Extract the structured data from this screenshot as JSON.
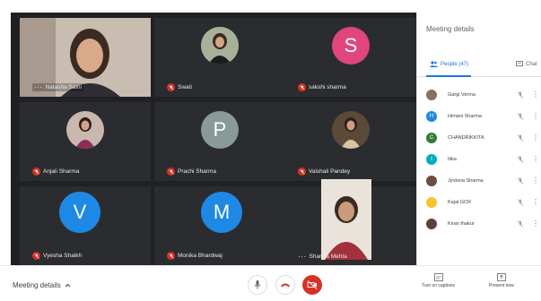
{
  "participants": [
    {
      "name": "Natasha Saini"
    },
    {
      "name": "Swati"
    },
    {
      "name": "sakshi sharma",
      "initial": "S",
      "color": "#e0457b"
    },
    {
      "name": "Anjali Sharma"
    },
    {
      "name": "Prachi Sharma",
      "initial": "P",
      "color": "#8a9a9a"
    },
    {
      "name": "Vaishali Pandey"
    },
    {
      "name": "Vyesha Shaikh",
      "initial": "V",
      "color": "#1e88e5"
    },
    {
      "name": "Monika Bhardwaj",
      "initial": "M",
      "color": "#1e88e5"
    },
    {
      "name": "Sharoja Mehta"
    }
  ],
  "panel": {
    "title": "Meeting details",
    "people_tab": "People (47)",
    "chat_tab": "Chat",
    "people": [
      {
        "name": "Gargi Verma",
        "avatar_color": "#8d6e63"
      },
      {
        "name": "Himani Sharma",
        "initial": "H",
        "avatar_color": "#1e88e5"
      },
      {
        "name": "CHANDRIKKITA",
        "initial": "C",
        "avatar_color": "#2e7d32"
      },
      {
        "name": "Ilika",
        "initial": "I",
        "avatar_color": "#00acc1"
      },
      {
        "name": "Jyotsna Sharma",
        "avatar_color": "#6d4c41"
      },
      {
        "name": "Kajal GCR",
        "avatar_color": "#fbc02d"
      },
      {
        "name": "Kiran thakur",
        "avatar_color": "#5d4037"
      }
    ]
  },
  "bottom": {
    "meeting_details": "Meeting details",
    "captions": "Turn on captions",
    "present": "Present now"
  }
}
